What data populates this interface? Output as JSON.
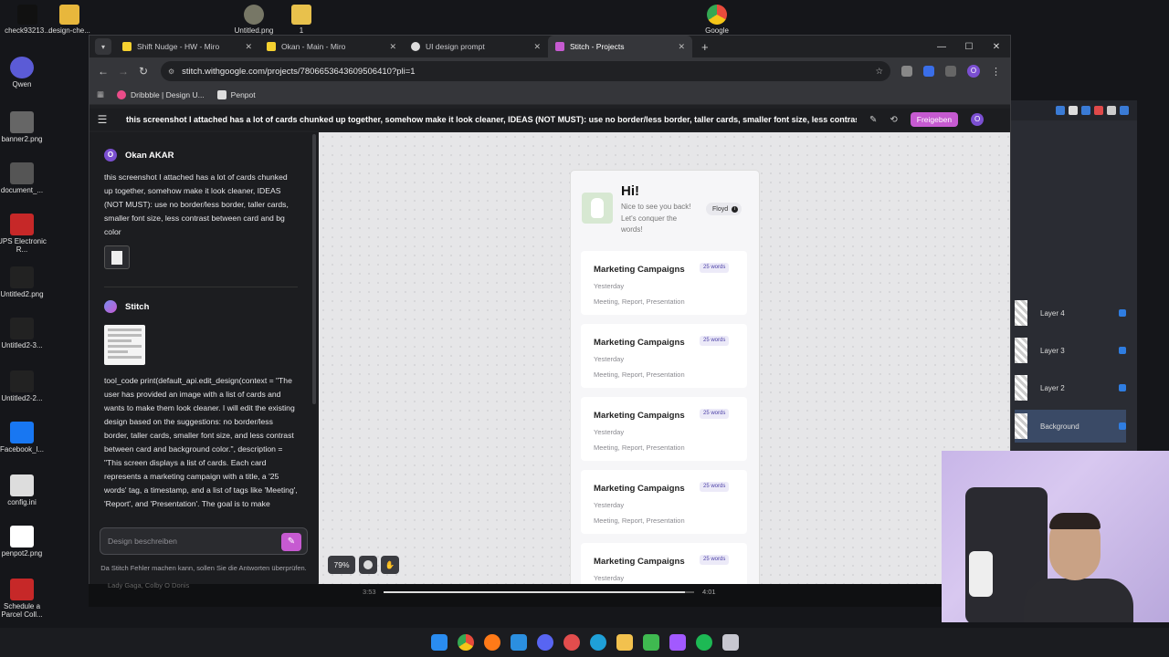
{
  "desktop": {
    "top_icons": [
      {
        "label": "check93213...",
        "color": "#111111"
      },
      {
        "label": "design-che...",
        "color": "#e8b73c"
      },
      {
        "label": "Untitled.png",
        "color": "#777766"
      },
      {
        "label": "1",
        "color": "#e8c14c"
      },
      {
        "label": "Google",
        "color": "#e84b3c"
      }
    ],
    "left_icons": [
      {
        "label": "Qwen",
        "color": "#5b5bd6"
      },
      {
        "label": "banner2.png",
        "color": "#666666"
      },
      {
        "label": "document_...",
        "color": "#555555"
      },
      {
        "label": "UPS Electronic R...",
        "color": "#c62828"
      },
      {
        "label": "Untitled2.png",
        "color": "#222222"
      },
      {
        "label": "Untitled2-3...",
        "color": "#222222"
      },
      {
        "label": "Untitled2-2...",
        "color": "#222222"
      },
      {
        "label": "Facebook_l...",
        "color": "#1877f2"
      },
      {
        "label": "config.ini",
        "color": "#dddddd"
      },
      {
        "label": "penpot2.png",
        "color": "#ffffff"
      },
      {
        "label": "Schedule a Parcel Coll...",
        "color": "#c62828"
      }
    ]
  },
  "layers_panel": {
    "items": [
      "Layer 4",
      "Layer 3",
      "Layer 2",
      "Background"
    ]
  },
  "browser": {
    "tabs": [
      {
        "label": "Shift Nudge - HW - Miro",
        "fav_color": "#f5d130"
      },
      {
        "label": "Okan - Main - Miro",
        "fav_color": "#f5d130"
      },
      {
        "label": "UI design prompt",
        "fav_color": "#dddddd"
      },
      {
        "label": "Stitch - Projects",
        "fav_color": "#c65ad1"
      }
    ],
    "url": "stitch.withgoogle.com/projects/7806653643609506410?pli=1",
    "bookmarks": [
      {
        "label": "Dribbble | Design U...",
        "fav_color": "#ea4c89"
      },
      {
        "label": "Penpot",
        "fav_color": "#dddddd"
      }
    ],
    "profile_initial": "O"
  },
  "stitch": {
    "prompt_title": "this screenshot I attached has a lot of cards chunked up together, somehow make it look cleaner, IDEAS (NOT MUST): use no border/less border, taller cards, smaller font size, less contrast between card and bg color",
    "share_label": "Freigeben",
    "user_initial": "O",
    "user": {
      "name": "Okan AKAR",
      "message": "this screenshot I attached has a lot of cards chunked up together, somehow make it look cleaner, IDEAS (NOT MUST): use no border/less border, taller cards, smaller font size, less contrast between card and bg color"
    },
    "bot": {
      "name": "Stitch",
      "message": "tool_code print(default_api.edit_design(context = \"The user has provided an image with a list of cards and wants to make them look cleaner. I will edit the existing design based on the suggestions: no border/less border, taller cards, smaller font size, and less contrast between card and background color.\", description = \"This screen displays a list of cards. Each card represents a marketing campaign with a title, a '25 words' tag, a timestamp, and a list of tags like 'Meeting', 'Report', and 'Presentation'. The goal is to make"
    },
    "input_placeholder": "Design beschreiben",
    "disclaimer": "Da Stitch Fehler machen kann, sollen Sie die Antworten überprüfen.",
    "zoom": "79%"
  },
  "design": {
    "greeting": "Hi!",
    "subtitle": "Nice to see you back! Let's conquer the words!",
    "user_pill": "Floyd",
    "cards": [
      {
        "title": "Marketing Campaigns",
        "tag": "25 words",
        "date": "Yesterday",
        "tags": "Meeting, Report, Presentation"
      },
      {
        "title": "Marketing Campaigns",
        "tag": "25 words",
        "date": "Yesterday",
        "tags": "Meeting, Report, Presentation"
      },
      {
        "title": "Marketing Campaigns",
        "tag": "25 words",
        "date": "Yesterday",
        "tags": "Meeting, Report, Presentation"
      },
      {
        "title": "Marketing Campaigns",
        "tag": "25 words",
        "date": "Yesterday",
        "tags": "Meeting, Report, Presentation"
      },
      {
        "title": "Marketing Campaigns",
        "tag": "25 words",
        "date": "Yesterday",
        "tags": ""
      }
    ]
  },
  "video": {
    "caption": "Lady Gaga, Colby O Donis",
    "current_time": "3:53",
    "duration": "4:01",
    "progress": 0.97
  },
  "taskbar": {
    "apps": [
      "windows-start",
      "chrome",
      "firefox",
      "vscode",
      "discord",
      "app-red",
      "edge",
      "file-explorer",
      "terminal-app",
      "figma",
      "spotify",
      "app-generic"
    ]
  }
}
